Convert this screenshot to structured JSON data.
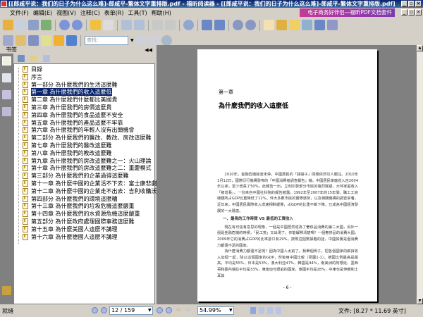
{
  "window": {
    "title": "[[郎咸平说：我们的日子为什么这么难]-郎咸平-繁体文字重排版.pdf - 福昕阅读器 - [[郎咸平说：我们的日子为什么这么难]-郎咸平-繁体文字重排版.pdf]"
  },
  "menu": [
    "文件(F)",
    "编辑(E)",
    "视图(V)",
    "注释(C)",
    "表单(R)",
    "工具(T)",
    "帮助(H)"
  ],
  "ad_banner": "电子商务好伴侣—福昕PDF文档套件",
  "find_placeholder": "查找:",
  "panel": {
    "title": "书签"
  },
  "bookmarks": [
    "目錄",
    "序言",
    "第一部分 為什麼我們的生活這麼難",
    "第一章 為什麼我們的收入這麼低",
    "第二章 為什麼我們什麼都比美國貴",
    "第三章 為什麼我們的房價這麼貴",
    "第四章 為什麼我們的食品這麼不安全",
    "第五章 為什麼我們的產品這麼不牢靠",
    "第六章 為什麼我們的年輕人沒有出頭機會",
    "第二部分 為什麼我們的醫改、教改、房改這麼難",
    "第七章 為什麼我們的醫改這麼難",
    "第八章 為什麼我們的教改這麼難",
    "第九章 為什麼我們的房改這麼難之一：火山理論",
    "第十章 為什麼我們的房改這麼難之二：重慶模式",
    "第三部分 為什麼我們的企業過得這麼難",
    "第十一章 為什麼中國的企業活不下去：富士康悲劇",
    "第十二章 為什麼中國的企業走不出去：吉利收購沃爾沃",
    "第四部分 為什麼我們的環境這麼糟",
    "第十三章 為什麼我們的垃圾危機這麼嚴重",
    "第十四章 為什麼我們的水資源危機這麼嚴重",
    "第五部分 為什麼政府處理國際事務這麼難",
    "第十五章 為什麼美國人這麼不講理",
    "第十六章 為什麼德國人這麼不講理"
  ],
  "selected_bookmark": 3,
  "page": {
    "chapter": "第一章",
    "title": "為什麼我們的收入這麼低",
    "paragraphs": [
      "2010年，金融危機餘波未停，中國居民的「錢袋子」問題依然引人關注。2010年1月12日，國際衍行機構發佈的「中國消費者調查報告」稱，中國居民家庭收入自2004年以來，至少增長了50%。此報告一出，立刻引發部分市民的強烈質疑，大呼家庭收入「被增長」。一份來自中國社科院的報告披露，1992年至2007年的15年間，職工工資總額所占GDP比重降低了12%。伴大多數市民的實際感受，以及相關機構的調查來看，近年來，中國居民實際收入增速相對緩慢，占GDP的比重不斷下降，已成為中國經濟發展的一大隱患。",
      "現在有可信有意思的現象，一個是中國居然成為了奢侈品消費的第二大國，另外一個是金融危機的時候，「民工荒」又出現了。你能解釋清楚嗎？一個奢侈品的消費大國，2009年它的消費占GDP的比率卻只有29%，按照這個數據看的話，中國其實是個消費力都還不足的國家。",
      "為什麼消費力都還不足呢？因為中國人太窮了。我舉個例子，把各個國家的薪資收入加個一起，除以這個國家的GDP，然後用中國比較（見圖1-1）。德國比例最高是最高，平均是55%，日本是53%，澳大利亞47%，韓國是44%，南美洲的阿根廷、墨西哥和委內瑞拉平均是33%，東南亞也很窮的國家，泰國平均是28%，中東也是伊朗和土耳其"
    ],
    "section_heading": "一、最長的工作時間 VS 最低的工資收入",
    "page_number": "- 6 -"
  },
  "status": {
    "ready": "就绪",
    "page_indicator": "12 / 159",
    "zoom": "54.99%",
    "file_size": "文件: [8.27 * 11.69 英寸]"
  }
}
